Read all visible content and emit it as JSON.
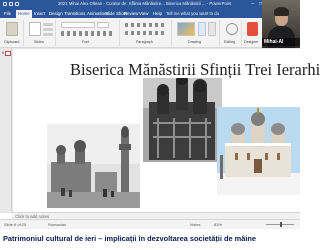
{
  "window": {
    "title": "2021 Mihai Alex Oltean - Curator de: Sfânta Mănăstire... Biserica Mănăstirii ... - PowerPoint",
    "colors": {
      "titlebar": "#2b579a",
      "ribbon": "#f3f3f3",
      "caption": "#0b1d52",
      "thumb_selected": "#c0504d"
    }
  },
  "ribbon_tabs": [
    "File",
    "Home",
    "Insert",
    "Design",
    "Transitions",
    "Animations",
    "Slide Show",
    "Review",
    "View",
    "Help"
  ],
  "ribbon_search": "Tell me what you want to do",
  "ribbon_groups": [
    "Clipboard",
    "Slides",
    "Font",
    "Paragraph",
    "Drawing",
    "Editing",
    "Designer"
  ],
  "thumbnails": {
    "current_number": "6"
  },
  "slide": {
    "title": "Biserica Mănăstirii Sfinții Trei Ierarhi",
    "photos": [
      {
        "label": "old-photo-street-church",
        "style": "black-and-white"
      },
      {
        "label": "old-photo-church-towers",
        "style": "black-and-white"
      },
      {
        "label": "photo-church-in-snow",
        "style": "color"
      }
    ]
  },
  "notes": {
    "placeholder": "Click to add notes"
  },
  "statusbar": {
    "left": "Slide 6 of 25",
    "language": "Romanian",
    "notes_label": "Notes",
    "zoom": "83%"
  },
  "webcam": {
    "name": "Mihai-Al"
  },
  "caption": {
    "text": "Patrimoniul cultural de ieri – implicații în dezvoltarea societății de mâine"
  }
}
